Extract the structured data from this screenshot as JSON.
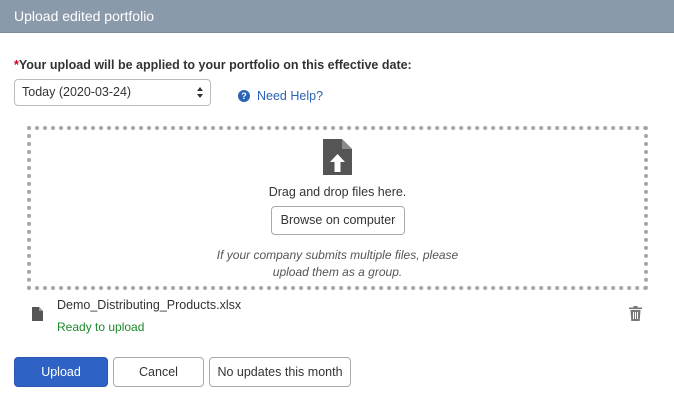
{
  "dialog": {
    "title": "Upload edited portfolio"
  },
  "effective_date": {
    "required_marker": "*",
    "label": "Your upload will be applied to your portfolio on this effective date:",
    "selected": "Today (2020-03-24)"
  },
  "help": {
    "icon": "question-circle-icon",
    "label": "Need Help?"
  },
  "dropzone": {
    "icon": "file-upload-icon",
    "instruction": "Drag and drop files here.",
    "browse_label": "Browse on computer",
    "note_line1": "If your company submits multiple files, please",
    "note_line2": "upload them as a group."
  },
  "file": {
    "icon": "file-icon",
    "name": "Demo_Distributing_Products.xlsx",
    "status": "Ready to upload",
    "delete_icon": "trash-icon"
  },
  "actions": {
    "upload_label": "Upload",
    "cancel_label": "Cancel",
    "no_updates_label": "No updates this month"
  },
  "colors": {
    "header_bg": "#8a9aab",
    "primary": "#2e62c4",
    "link": "#2b63b5",
    "success": "#1e8a2a",
    "required": "#d0021b"
  }
}
